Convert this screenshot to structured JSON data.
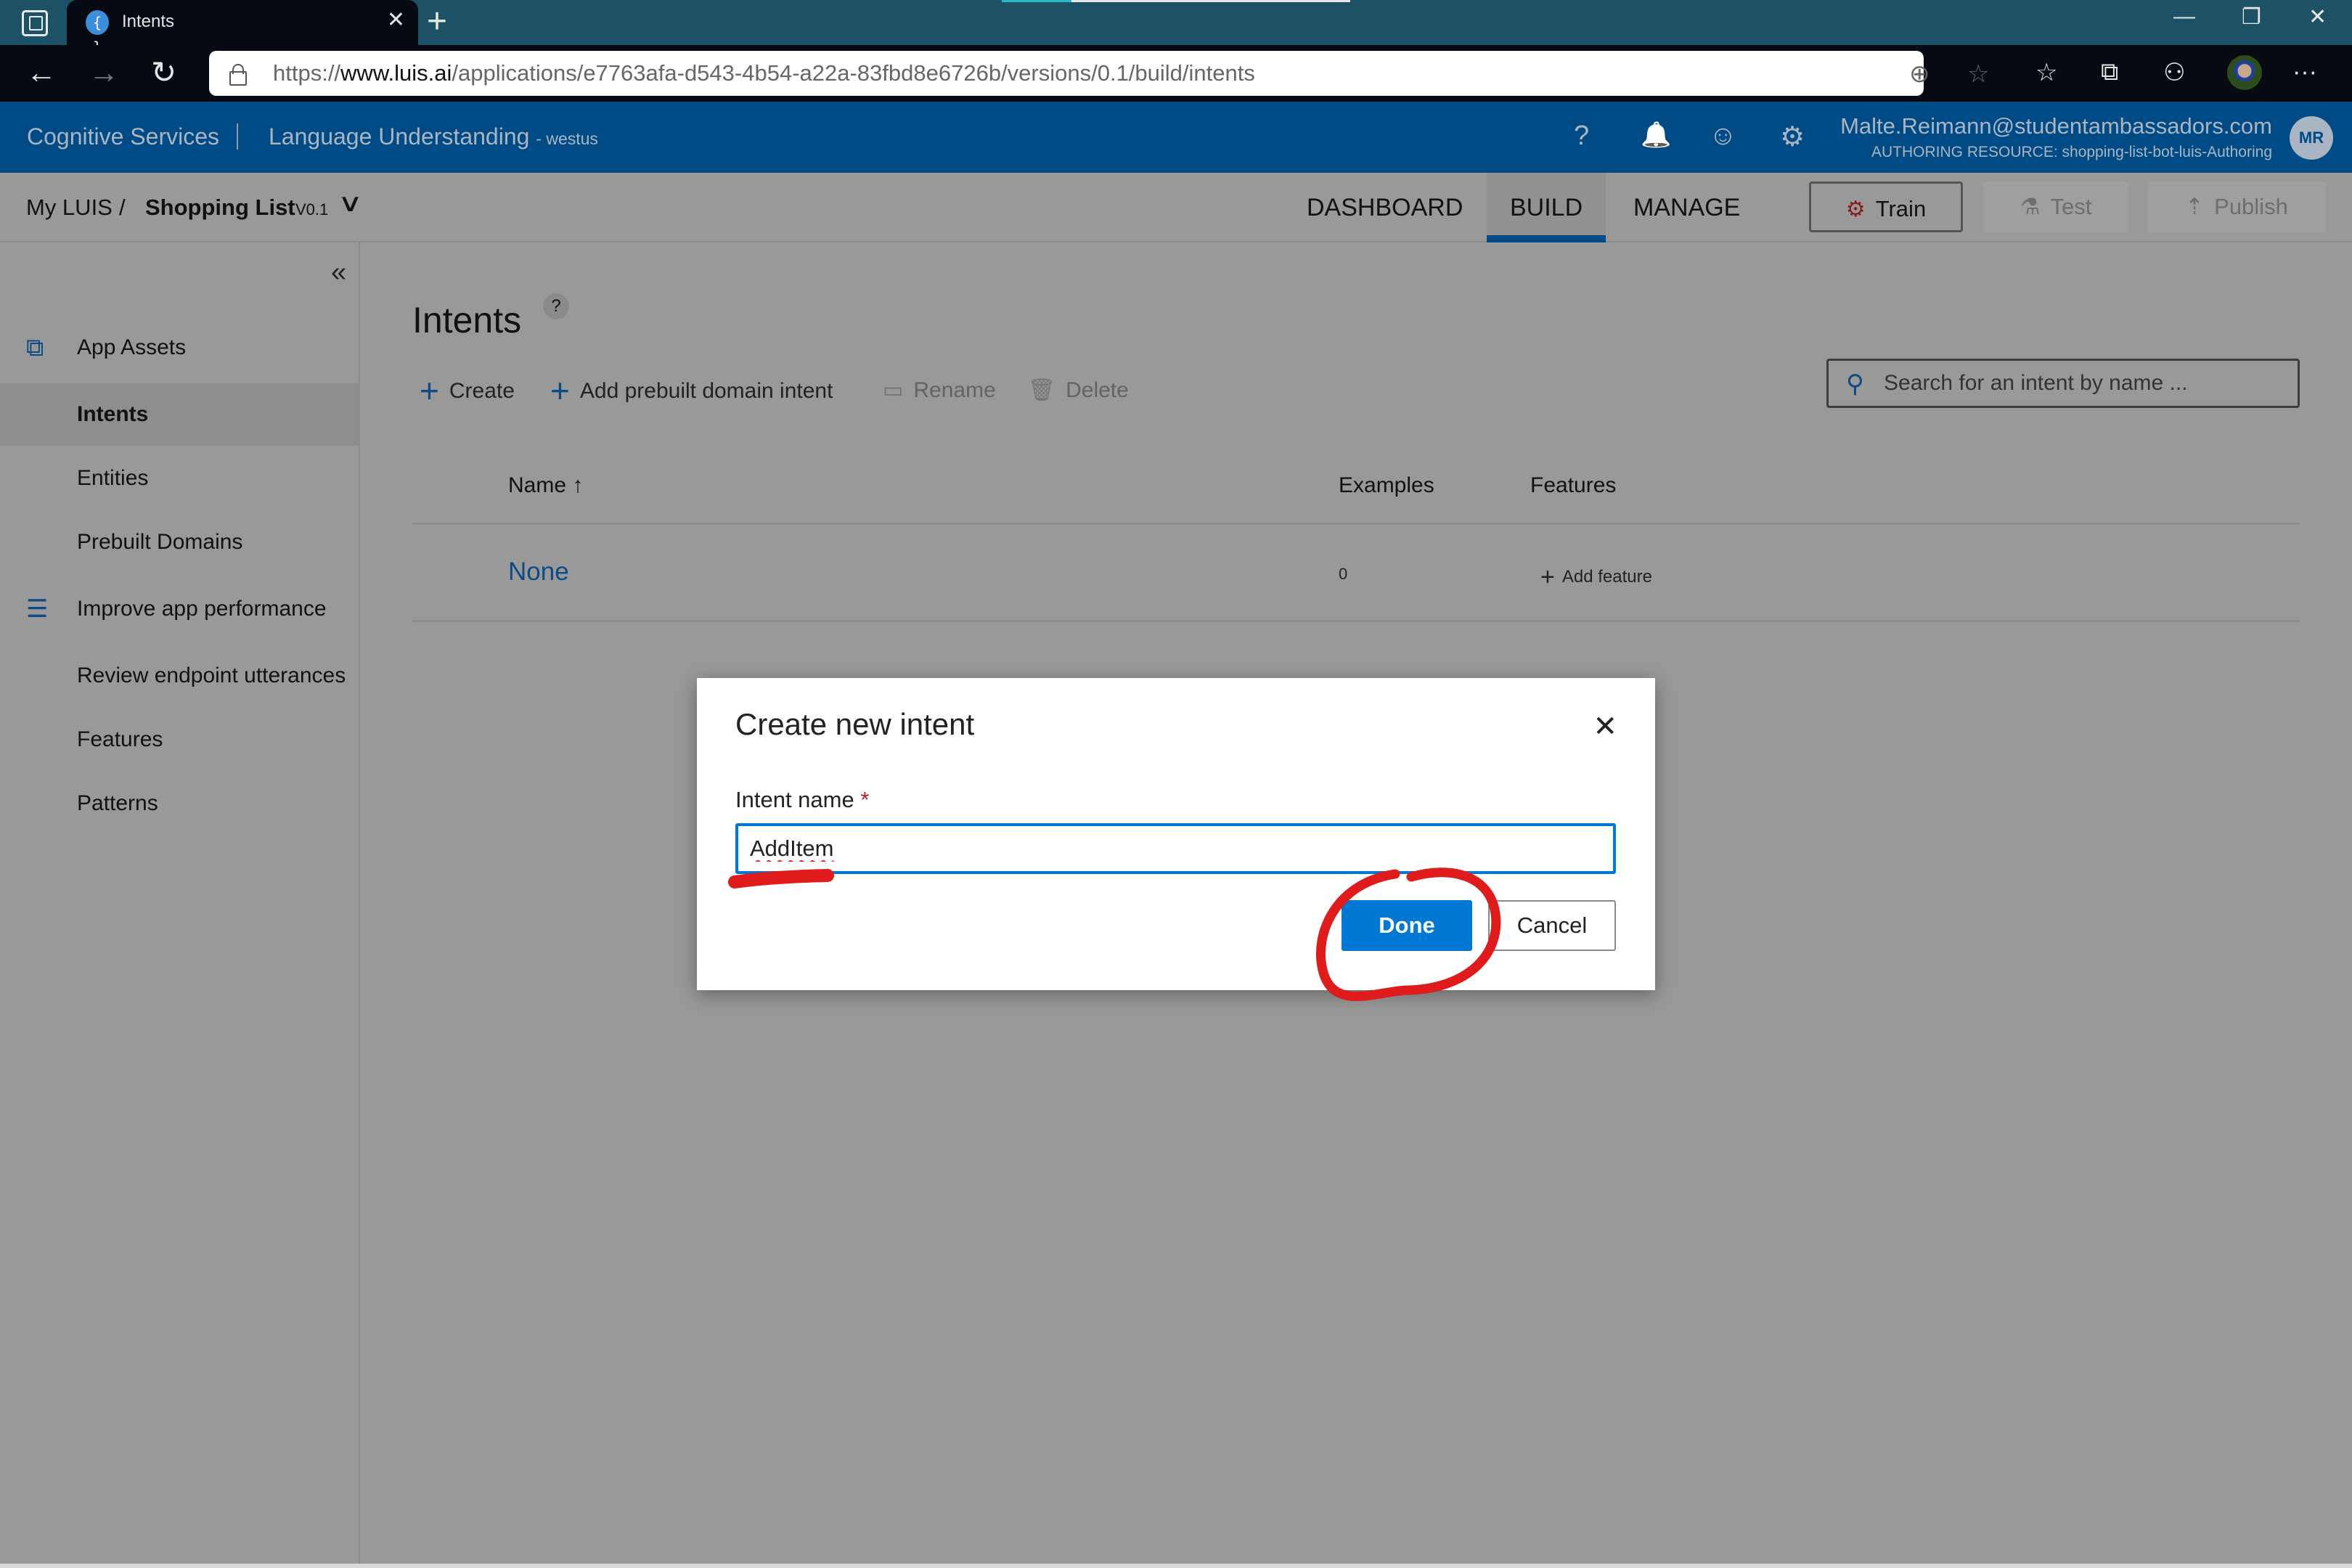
{
  "browser": {
    "tab_title": "Intents",
    "favicon_glyph": "{ }",
    "url_prefix": "https://",
    "url_host": "www.luis.ai",
    "url_path": "/applications/e7763afa-d543-4b54-a22a-83fbd8e6726b/versions/0.1/build/intents",
    "new_tab_glyph": "+",
    "close_glyph": "✕",
    "icons": {
      "back": "←",
      "forward": "→",
      "refresh": "↻",
      "zoom": "⊕",
      "favorite_add": "☆",
      "favorites": "☆",
      "collections": "⧉",
      "share": "⚇",
      "more": "···",
      "minimize": "—",
      "restore": "❐",
      "close": "✕"
    }
  },
  "header": {
    "brand": "Cognitive Services",
    "product": "Language Understanding",
    "region": "- westus",
    "icons": {
      "help": "?",
      "notifications": "🔔",
      "feedback": "☺",
      "settings": "⚙"
    },
    "user_email": "Malte.Reimann@studentambassadors.com",
    "authoring_resource": "AUTHORING RESOURCE:  shopping-list-bot-luis-Authoring",
    "avatar_initials": "MR"
  },
  "app_bar": {
    "breadcrumb_root": "My LUIS",
    "breadcrumb_sep": "/",
    "app_name": "Shopping List",
    "version": "V0.1",
    "version_chevron": "∨",
    "tabs": [
      {
        "label": "DASHBOARD",
        "active": false
      },
      {
        "label": "BUILD",
        "active": true
      },
      {
        "label": "MANAGE",
        "active": false
      }
    ],
    "train_label": "Train",
    "test_label": "Test",
    "publish_label": "Publish"
  },
  "sidebar": {
    "collapse_glyph": "«",
    "items": [
      {
        "label": "App Assets",
        "icon": "app-assets",
        "selected": false
      },
      {
        "label": "Intents",
        "selected": true
      },
      {
        "label": "Entities",
        "selected": false
      },
      {
        "label": "Prebuilt Domains",
        "selected": false
      },
      {
        "label": "Improve app performance",
        "icon": "sliders",
        "selected": false
      },
      {
        "label": "Review endpoint utterances",
        "selected": false
      },
      {
        "label": "Features",
        "selected": false
      },
      {
        "label": "Patterns",
        "selected": false
      }
    ]
  },
  "main": {
    "title": "Intents",
    "help_glyph": "?",
    "commands": {
      "create": "Create",
      "add_prebuilt": "Add prebuilt domain intent",
      "rename": "Rename",
      "delete": "Delete"
    },
    "search_placeholder": "Search for an intent by name ...",
    "table": {
      "columns": [
        "Name",
        "Examples",
        "Features"
      ],
      "sort_glyph": "↑",
      "rows": [
        {
          "name": "None",
          "examples": "0",
          "features_action": "Add feature"
        }
      ]
    }
  },
  "dialog": {
    "title": "Create new intent",
    "close_glyph": "✕",
    "field_label": "Intent name",
    "required_mark": "*",
    "field_value": "AddItem",
    "done_label": "Done",
    "cancel_label": "Cancel"
  },
  "colors": {
    "luis_header": "#004a85",
    "primary_button": "#0078d4",
    "annotation_red": "#e01b1b",
    "link_blue": "#0e4a86"
  }
}
